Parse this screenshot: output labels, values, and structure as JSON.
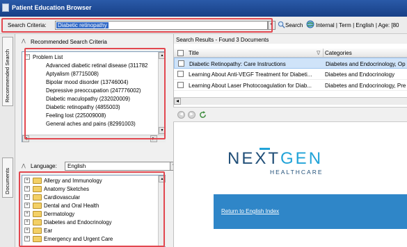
{
  "window": {
    "title": "Patient Education Browser"
  },
  "toolbar": {
    "criteria_label": "Search Criteria:",
    "criteria_value": "Diabetic retinopathy",
    "search_label": "Search",
    "filters_text": "Internal | Term | English | Age: [80"
  },
  "side_tabs": {
    "recommended": "Recommended Search",
    "documents": "Documents"
  },
  "recommended": {
    "title": "Recommended Search Criteria",
    "root": "Problem List",
    "items": [
      "Advanced diabetic retinal disease (311782",
      "Aptyalism (87715008)",
      "Bipolar mood disorder (13746004)",
      "Depressive preoccupation (247776002)",
      "Diabetic maculopathy (232020009)",
      "Diabetic retinopathy (4855003)",
      "Feeling lost (225009008)",
      "General aches and pains (82991003)"
    ]
  },
  "documents": {
    "language_label": "Language:",
    "language_value": "English",
    "folders": [
      "Allergy and Immunology",
      "Anatomy Sketches",
      "Cardiovascular",
      "Dental and Oral Health",
      "Dermatology",
      "Diabetes and Endocrinology",
      "Ear",
      "Emergency and Urgent Care"
    ]
  },
  "results": {
    "header": "Search Results - Found 3 Documents",
    "columns": {
      "title": "Title",
      "categories": "Categories"
    },
    "rows": [
      {
        "title": "Diabetic Retinopathy: Care Instructions",
        "categories": "Diabetes and Endocrinology, Op",
        "selected": true
      },
      {
        "title": "Learning About Anti-VEGF Treatment for Diabeti...",
        "categories": "Diabetes and Endocrinology",
        "selected": false
      },
      {
        "title": "Learning About Laser Photocoagulation for Diab...",
        "categories": "Diabetes and Endocrinology, Pre",
        "selected": false
      }
    ]
  },
  "viewer": {
    "logo_part1": "NEXT",
    "logo_part2": "GEN",
    "logo_sub": "HEALTHCARE",
    "link": "Return to English Index"
  },
  "colors": {
    "highlight": "#e2474f",
    "brand_dark": "#214f78",
    "brand_light": "#21a3d8",
    "banner": "#2f86c8"
  }
}
